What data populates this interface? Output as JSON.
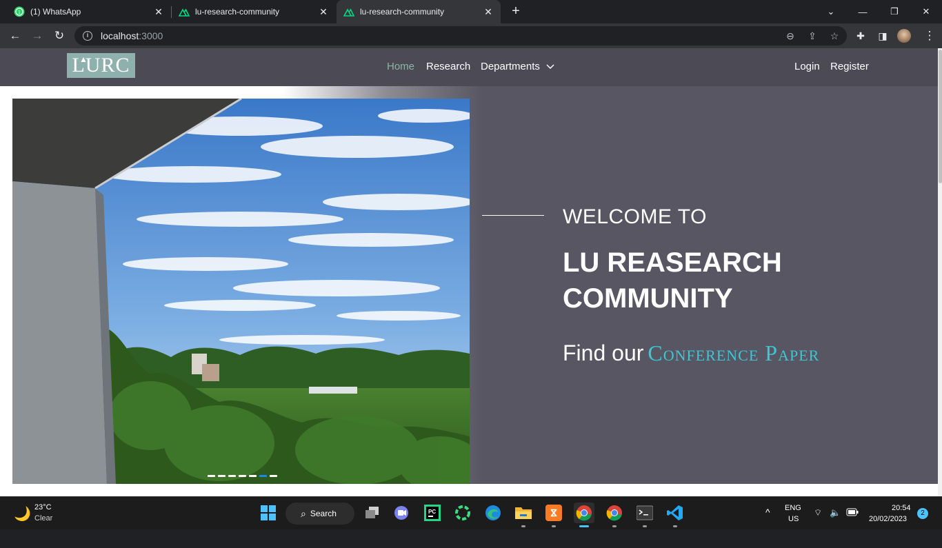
{
  "browser": {
    "tabs": [
      {
        "title": "(1) WhatsApp",
        "icon": "whatsapp-icon"
      },
      {
        "title": "lu-research-community",
        "icon": "nuxt-icon"
      },
      {
        "title": "lu-research-community",
        "icon": "nuxt-icon",
        "active": true
      }
    ],
    "url_host": "localhost",
    "url_port": ":3000"
  },
  "navbar": {
    "logo_text": "LURC",
    "links": {
      "home": "Home",
      "research": "Research",
      "departments": "Departments",
      "login": "Login",
      "register": "Register"
    },
    "active_color": "#8fb3ad"
  },
  "hero": {
    "welcome": "WELCOME TO",
    "title": "LU REASEARCH COMMUNITY",
    "find_prefix": "Find our",
    "find_accent": "Conference Paper",
    "accent_color": "#3ec6d4",
    "background_color": "#575662",
    "carousel_slides": 7,
    "carousel_active": 6
  },
  "taskbar": {
    "weather_temp": "23°C",
    "weather_desc": "Clear",
    "search_label": "Search",
    "lang_top": "ENG",
    "lang_bottom": "US",
    "time": "20:54",
    "date": "20/02/2023",
    "notifications": "2"
  }
}
